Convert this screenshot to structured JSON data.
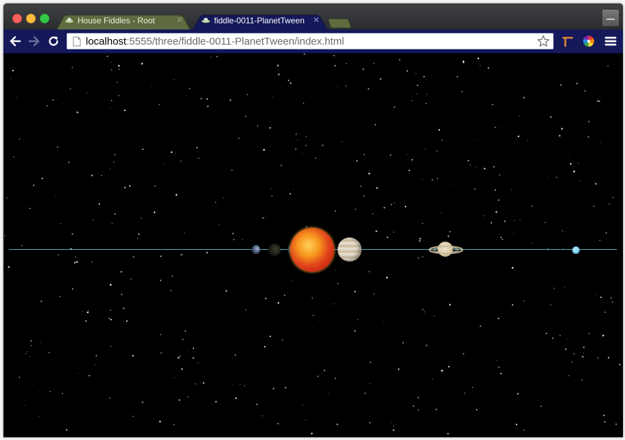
{
  "browser": {
    "tabs": [
      {
        "label": "House Fiddles - Root",
        "active": false
      },
      {
        "label": "fiddle-0011-PlanetTween",
        "active": true
      }
    ],
    "address": {
      "host": "localhost",
      "path": ":5555/three/fiddle-0011-PlanetTween/index.html"
    },
    "icons": {
      "back": "arrow-left-icon",
      "forward": "arrow-right-icon",
      "reload": "reload-icon",
      "bookmark": "star-icon",
      "extension_1": "t-square-icon",
      "extension_2": "color-wheel-icon",
      "menu": "hamburger-menu-icon"
    }
  },
  "scene": {
    "background_color": "#000000",
    "orbit_line_color": "#4fb4be",
    "bodies": [
      "mercury",
      "venus",
      "earth",
      "sun",
      "jupiter",
      "saturn",
      "uranus"
    ]
  }
}
